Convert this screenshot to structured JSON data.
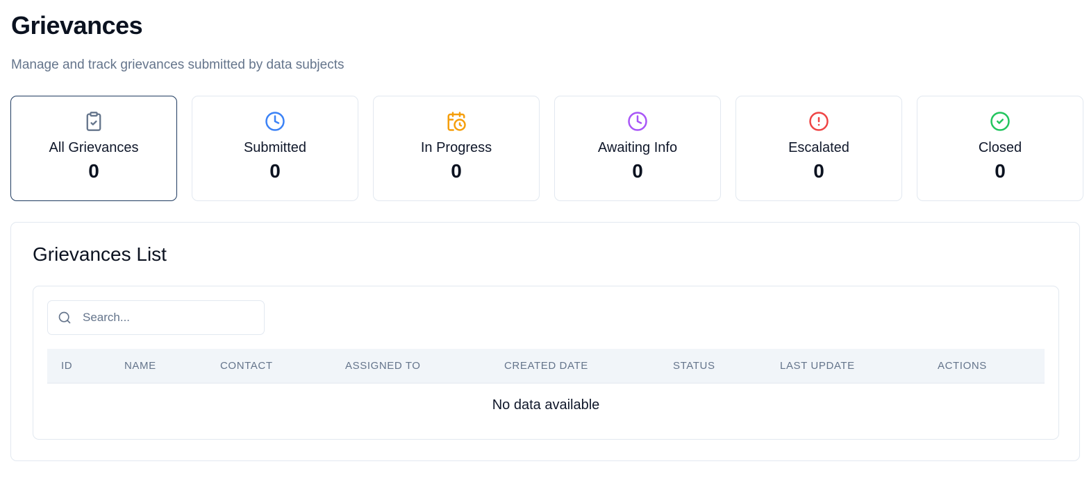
{
  "header": {
    "title": "Grievances",
    "subtitle": "Manage and track grievances submitted by data subjects"
  },
  "cards": [
    {
      "label": "All Grievances",
      "count": "0",
      "icon": "clipboard-check-icon",
      "color": "#64748b",
      "active": true
    },
    {
      "label": "Submitted",
      "count": "0",
      "icon": "clock-icon",
      "color": "#3b82f6"
    },
    {
      "label": "In Progress",
      "count": "0",
      "icon": "calendar-clock-icon",
      "color": "#f59e0b"
    },
    {
      "label": "Awaiting Info",
      "count": "0",
      "icon": "clock-icon",
      "color": "#a855f7"
    },
    {
      "label": "Escalated",
      "count": "0",
      "icon": "alert-circle-icon",
      "color": "#ef4444"
    },
    {
      "label": "Closed",
      "count": "0",
      "icon": "check-circle-icon",
      "color": "#22c55e"
    }
  ],
  "list": {
    "title": "Grievances List",
    "search_placeholder": "Search...",
    "search_value": "",
    "columns": [
      "ID",
      "NAME",
      "CONTACT",
      "ASSIGNED TO",
      "CREATED DATE",
      "STATUS",
      "LAST UPDATE",
      "ACTIONS"
    ],
    "rows": [],
    "empty_text": "No data available"
  }
}
